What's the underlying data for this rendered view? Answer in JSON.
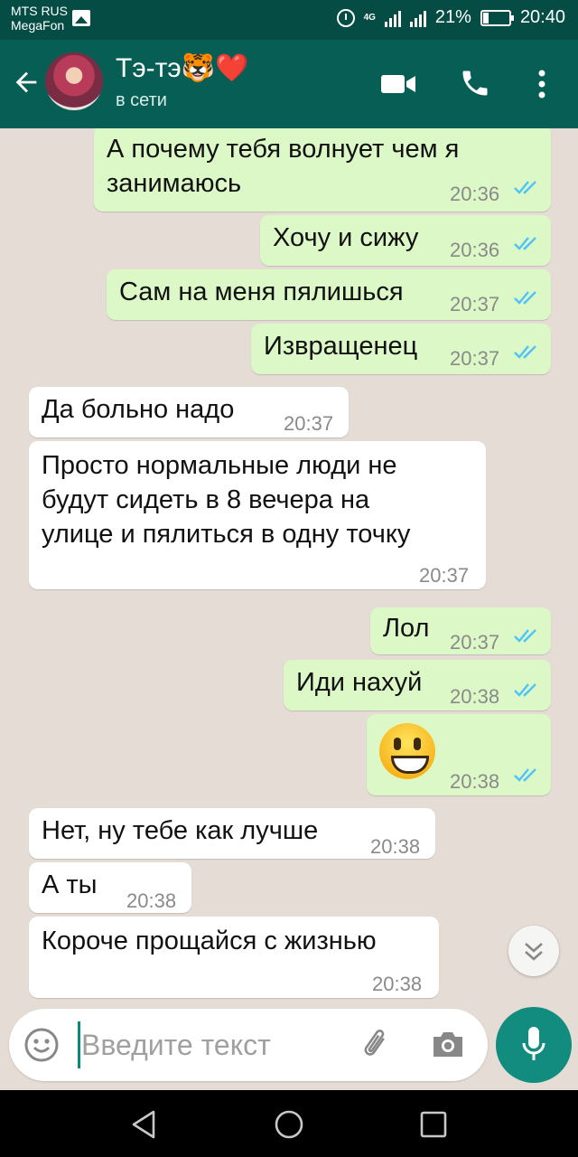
{
  "status_bar": {
    "carrier_line1": "MTS RUS",
    "carrier_line2": "MegaFon",
    "network": "4G",
    "battery": "21%",
    "time": "20:40"
  },
  "header": {
    "contact_name": "Тэ-тэ🐯❤️",
    "contact_status": "в сети"
  },
  "messages": [
    {
      "direction": "out",
      "text": "А почему тебя волнует чем я\nзанимаюсь",
      "time": "20:36",
      "read": true
    },
    {
      "direction": "out",
      "text": "Хочу и сижу",
      "time": "20:36",
      "read": true
    },
    {
      "direction": "out",
      "text": "Сам на меня пялишься",
      "time": "20:37",
      "read": true
    },
    {
      "direction": "out",
      "text": "Извращенец",
      "time": "20:37",
      "read": true
    },
    {
      "direction": "in",
      "text": "Да больно надо",
      "time": "20:37"
    },
    {
      "direction": "in",
      "text": "Просто нормальные люди не\nбудут сидеть в 8 вечера на\nулице и пялиться в одну точку",
      "time": "20:37"
    },
    {
      "direction": "out",
      "text": "Лол",
      "time": "20:37",
      "read": true
    },
    {
      "direction": "out",
      "text": "Иди нахуй",
      "time": "20:38",
      "read": true
    },
    {
      "direction": "out",
      "emoji": "grinning-face",
      "time": "20:38",
      "read": true
    },
    {
      "direction": "in",
      "text": "Нет, ну тебе как лучше",
      "time": "20:38"
    },
    {
      "direction": "in",
      "text": "А ты",
      "time": "20:38"
    },
    {
      "direction": "in",
      "text": "Короче прощайся с жизнью",
      "time": "20:38"
    }
  ],
  "input": {
    "placeholder": "Введите текст"
  },
  "colors": {
    "header": "#075e54",
    "status_bar": "#054d44",
    "chat_background": "#e5ddd5",
    "outgoing_bubble": "#dcf8c6",
    "incoming_bubble": "#ffffff",
    "read_ticks": "#4fc3f7",
    "mic_button": "#128c7e"
  },
  "icons": {
    "back": "arrow-left-icon",
    "video": "video-camera-icon",
    "phone": "phone-icon",
    "menu": "more-vertical-icon",
    "emoji": "smiley-icon",
    "attach": "paperclip-icon",
    "camera": "camera-icon",
    "mic": "microphone-icon",
    "scroll": "double-chevron-down-icon"
  }
}
